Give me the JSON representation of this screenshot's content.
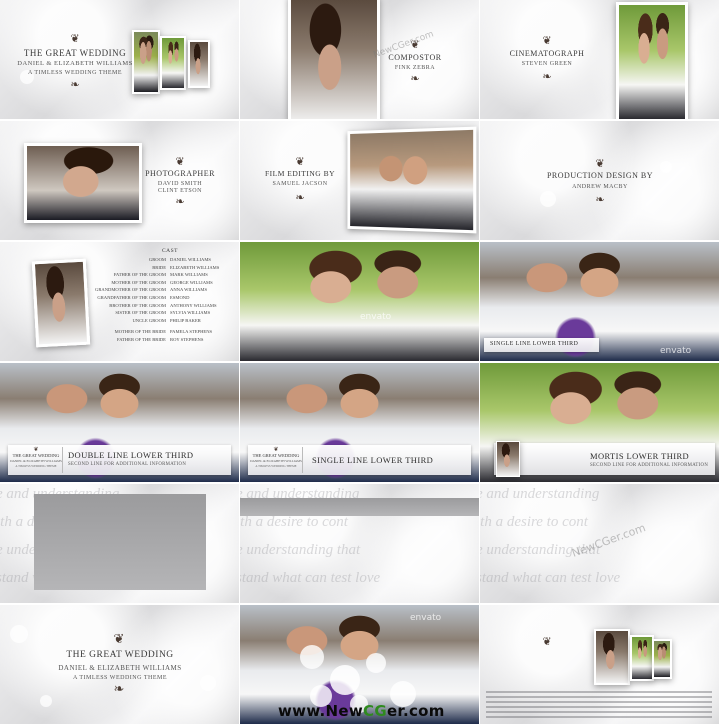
{
  "theme": {
    "accent": "#4a3b33",
    "brand_green": "#2f8a1f"
  },
  "frames": {
    "f1": {
      "title": "THE GREAT WEDDING",
      "names": "DANIEL & ELIZABETH WILLIAMS",
      "subtitle": "A TIMLESS WEDDING THEME"
    },
    "f2": {
      "role": "COMPOSTOR",
      "name": "FINK ZEBRA"
    },
    "f3": {
      "role": "CINEMATOGRAPH",
      "name": "STEVEN GREEN"
    },
    "f4": {
      "role": "PHOTOGRAPHER",
      "names": [
        "DAVID SMITH",
        "CLINT ETSON"
      ]
    },
    "f5": {
      "role": "FILM EDITING BY",
      "name": "SAMUEL JACSON"
    },
    "f6": {
      "role": "PRODUCTION DESIGN BY",
      "name": "ANDREW MACBY"
    },
    "f7": {
      "heading": "CAST",
      "rows": [
        {
          "role": "GROOM",
          "name": "DANIEL WILLIAMS"
        },
        {
          "role": "BRIDE",
          "name": "ELIZABETH WILLIAMS"
        },
        {
          "role": "FATHER OF THE GROOM",
          "name": "MARK WILLIAMS"
        },
        {
          "role": "MOTHER OF THE GROOM",
          "name": "GEORGE WILLIAMS"
        },
        {
          "role": "GRANDMOTHER OF THE GROOM",
          "name": "ANNA WILLIAMS"
        },
        {
          "role": "GRANDFATHER OF THE GROOM",
          "name": "ESMOND"
        },
        {
          "role": "BROTHER OF THE GROOM",
          "name": "ANTHONY WILLIAMS"
        },
        {
          "role": "SISTER OF THE GROOM",
          "name": "SYLVIA WILLIAMS"
        },
        {
          "role": "UNCLE GROOM",
          "name": "PHILIP BAKER"
        },
        {
          "role": "MOTHER OF THE BRIDE",
          "name": "PAMELA STEPHENS"
        },
        {
          "role": "FATHER OF THE BRIDE",
          "name": "ROY STEPHENS"
        }
      ]
    },
    "f9": {
      "lower_third": "SINGLE LINE LOWER THIRD"
    },
    "f10": {
      "badge_title": "THE GREAT WEDDING",
      "badge_names": "DANIEL & ELIZABETH WILLIAMS",
      "badge_subtitle": "A TIMLESS WEDDING THEME",
      "main": "DOUBLE LINE LOWER THIRD",
      "sub": "SECOND LINE FOR ADDITIONAL INFORMATION"
    },
    "f11": {
      "badge_title": "THE GREAT WEDDING",
      "badge_names": "DANIEL & ELIZABETH WILLIAMS",
      "badge_subtitle": "A TIMLESS WEDDING THEME",
      "main": "SINGLE LINE LOWER THIRD"
    },
    "f12": {
      "main": "MORTIS LOWER THIRD",
      "sub": "SECOND LINE FOR ADDITIONAL INFORMATION"
    },
    "script_lines": [
      "e and understanding",
      "ith a desire to cont",
      "e understanding that",
      "stand what can test love"
    ],
    "f16": {
      "title": "THE GREAT WEDDING",
      "names": "DANIEL & ELIZABETH WILLIAMS",
      "subtitle": "A TIMLESS WEDDING THEME"
    }
  },
  "watermarks": {
    "envato": "envato",
    "newcg": "NewCGer.com"
  },
  "footer": {
    "prefix": "www.",
    "brand_a": "New",
    "brand_b": "CG",
    "brand_c": "er",
    "suffix": ".com"
  }
}
